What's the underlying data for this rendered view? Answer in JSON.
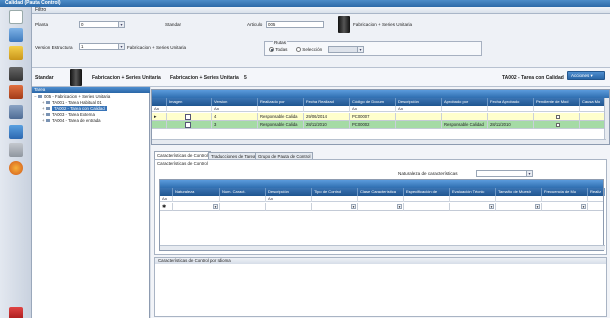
{
  "window": {
    "title": "Calidad (Pauta Control)"
  },
  "menu": {
    "filtros": "Filtro"
  },
  "filter": {
    "planta_label": "Planta",
    "planta_value": "0",
    "standar_label": "Standar",
    "articulo_label": "Articulo",
    "articulo_value": "005",
    "articulo_desc": "Fabricacion + Series Unitaria",
    "version_label": "Version Estructura",
    "version_value": "1",
    "version_desc": "Fabricacion + Series Unitaria",
    "rutas_label": "Rutas",
    "rutas_todas": "Todas",
    "rutas_seleccion": "Selección"
  },
  "header": {
    "standar": "Standar",
    "desc1": "Fabricacion + Series Unitaria",
    "desc2": "Fabricacion + Series Unitaria",
    "num": "5",
    "task": "TA002 - Tarea con Calidad",
    "acciones": "Acciones"
  },
  "tree": {
    "title": "Tarea",
    "nodes": [
      {
        "label": "005 - Fabricacion + Series Unitaria",
        "level": 0,
        "selected": false
      },
      {
        "label": "TA001 - Tarea Habitual 01",
        "level": 1,
        "selected": false
      },
      {
        "label": "TA002 - Tarea con Calidad",
        "level": 1,
        "selected": true
      },
      {
        "label": "TA003 - Tarea Externa",
        "level": 1,
        "selected": false
      },
      {
        "label": "TA004 - Tarea de entrada",
        "level": 1,
        "selected": false
      }
    ]
  },
  "grid": {
    "columns": [
      "",
      "Imagen",
      "Version",
      "Realizado por",
      "Fecha Realizad",
      "Código de Docum",
      "Descripción",
      "Aprobado por",
      "Fecha Aprobado",
      "Pendiente de Mod",
      "Causa Mo"
    ],
    "filter_row": [
      "Aa",
      "",
      "Aa",
      "",
      "",
      "Aa",
      "Aa",
      "",
      "",
      "",
      ""
    ],
    "rows": [
      {
        "version": "4",
        "realizado": "Responsable Calida",
        "fecha_realizado": "29/06/2014",
        "codigo": "PC00007",
        "descripcion": "",
        "aprobado": "",
        "fecha_aprobado": "",
        "color": "#ffffcc"
      },
      {
        "version": "3",
        "realizado": "Responsable Calida",
        "fecha_realizado": "28/11/2010",
        "codigo": "PC00002",
        "descripcion": "",
        "aprobado": "Responsable Calidad",
        "fecha_aprobado": "28/11/2010",
        "color": "#a5dba5"
      }
    ]
  },
  "tabs": [
    "Características de Control",
    "Traducciones de Tarea",
    "Grupo de Pauta de Control"
  ],
  "cc": {
    "panel_title": "Características de Control",
    "naturaleza_label": "Naturaleza de características",
    "columns": [
      "",
      "Naturaleza",
      "Num. Caract.",
      "Descripción",
      "Tipo de Control",
      "Clase Característica",
      "Especificación de",
      "Evaluación Técnic",
      "Tamaño de Muestr",
      "Frecuencia de Mu",
      "Realiz"
    ],
    "filter_row": [
      "Aa",
      "",
      "",
      "Aa",
      "",
      "",
      "",
      "",
      "",
      "",
      ""
    ]
  },
  "ccpi": {
    "title": "Características de Control por Idioma"
  }
}
